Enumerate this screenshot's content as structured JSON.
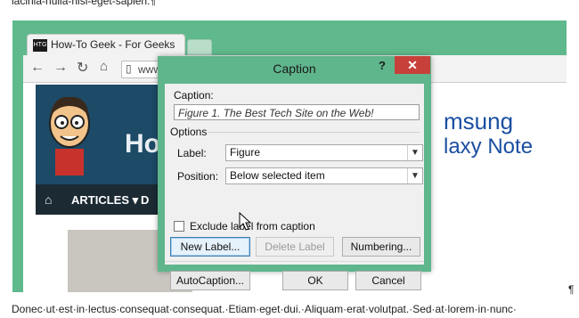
{
  "document": {
    "top_line": "lacinia-nulla-nisi-eget-sapien.¶",
    "bottom_line": "Donec·ut·est·in·lectus·consequat·consequat.·Etiam·eget·dui.·Aliquam·erat·volutpat.·Sed·at·lorem·in·nunc·",
    "pilcrow": "¶"
  },
  "browser": {
    "tab_title": "How-To Geek - For Geeks",
    "favicon_text": "HTG",
    "address_prefix": "www",
    "site_text_left": "How",
    "nav_label": "ARTICLES",
    "nav_label2": "D",
    "samsung_line1": "msung",
    "samsung_line2": "laxy Note"
  },
  "dialog": {
    "title": "Caption",
    "help_label": "?",
    "close_label": "✕",
    "caption_label": "Caption:",
    "caption_value": "Figure 1. The Best Tech Site on the Web!",
    "options_label": "Options",
    "label_label": "Label:",
    "label_value": "Figure",
    "position_label": "Position:",
    "position_value": "Below selected item",
    "exclude_label": "Exclude label from caption",
    "exclude_checked": false,
    "new_label_button": "New Label...",
    "delete_label_button": "Delete Label",
    "numbering_button": "Numbering...",
    "autocaption_button": "AutoCaption...",
    "ok_button": "OK",
    "cancel_button": "Cancel"
  },
  "colors": {
    "accent_green": "#5fb58c",
    "close_red": "#c7403a"
  }
}
